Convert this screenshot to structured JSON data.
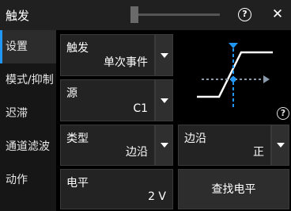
{
  "window": {
    "title": "触发"
  },
  "sidebar": {
    "items": [
      {
        "label": "设置",
        "active": true
      },
      {
        "label": "模式/抑制",
        "active": false
      },
      {
        "label": "迟滞",
        "active": false
      },
      {
        "label": "通道滤波",
        "active": false
      },
      {
        "label": "动作",
        "active": false
      }
    ]
  },
  "controls": {
    "trigger": {
      "label": "触发",
      "value": "单次事件"
    },
    "source": {
      "label": "源",
      "value": "C1"
    },
    "type": {
      "label": "类型",
      "value": "边沿"
    },
    "edge": {
      "label": "边沿",
      "value": "正"
    },
    "level": {
      "label": "电平",
      "value": "2 V"
    },
    "find_level": {
      "label": "查找电平"
    }
  },
  "icons": {
    "help": "?",
    "close": "✕"
  },
  "colors": {
    "accent": "#2196f3",
    "background": "#000000",
    "panel": "#232323"
  }
}
